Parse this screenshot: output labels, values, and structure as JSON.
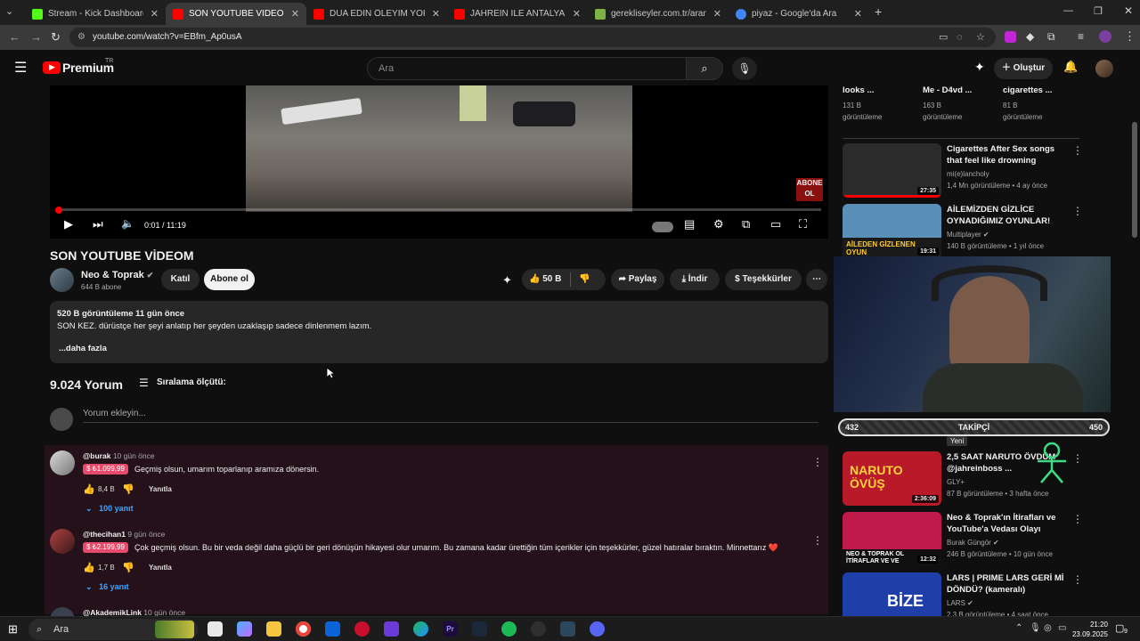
{
  "browser": {
    "tabs": [
      {
        "title": "Stream - Kick Dashboard",
        "color": "#53fc18"
      },
      {
        "title": "SON YOUTUBE VİDEOM - YouTube",
        "color": "#ff0000"
      },
      {
        "title": "DUA EDİN ÖLEYİM YOKSA ÇOK",
        "color": "#ff0000"
      },
      {
        "title": "JAHREIN İLE ANTALYA YEMEK T",
        "color": "#ff0000"
      },
      {
        "title": "gerekliseyler.com.tr/arama/İblek",
        "color": "#7cb342"
      },
      {
        "title": "piyaz - Google'da Ara",
        "color": "#4285f4"
      }
    ],
    "url": "youtube.com/watch?v=EBfm_Ap0usA",
    "new_tab_label": "+"
  },
  "youtube": {
    "logo_text": "Premium",
    "logo_region": "TR",
    "search_placeholder": "Ara",
    "create_label": "Oluştur"
  },
  "player": {
    "time": "0:01 / 11:19",
    "watermark": "ABONE OL",
    "progress_fraction": 0.0015
  },
  "video": {
    "title": "SON YOUTUBE VİDEOM",
    "channel": "Neo & Toprak",
    "subscribers": "644 B abone",
    "join_label": "Katıl",
    "subscribe_label": "Abone ol",
    "likes": "50 B",
    "share_label": "Paylaş",
    "download_label": "İndir",
    "thanks_label": "Teşekkürler",
    "description_meta": "520 B görüntüleme  11 gün önce",
    "description_text": "SON KEZ. dürüstçe her şeyi anlatıp her şeyden uzaklaşıp sadece dinlenmem lazım.",
    "more_label": "...daha fazla"
  },
  "comments": {
    "count_label": "9.024 Yorum",
    "sort_label": "Sıralama ölçütü:",
    "add_placeholder": "Yorum ekleyin...",
    "reply_label": "Yanıtla",
    "items": [
      {
        "user": "@burak",
        "time": "10 gün önce",
        "badge": "₺1.099,99",
        "text": "Geçmiş olsun, umarım toparlanıp aramıza dönersin.",
        "likes": "8,4 B",
        "replies": "100 yanıt"
      },
      {
        "user": "@thecihan1",
        "time": "9 gün önce",
        "badge": "₺2.199,99",
        "text": "Çok geçmiş olsun. Bu bir veda değil daha güçlü bir geri dönüşün hikayesi olur umarım. Bu zamana kadar ürettiğin tüm içerikler için teşekkürler, güzel hatıralar bıraktın. Minnettarız ❤️",
        "likes": "1,7 B",
        "replies": "16 yanıt"
      },
      {
        "user": "@AkademikLink",
        "time": "10 gün önce"
      }
    ]
  },
  "sidebar": {
    "top_row": [
      {
        "title": "looks ...",
        "views": "131 B",
        "unit": "görüntüleme"
      },
      {
        "title": "Me - D4vd ...",
        "views": "163 B",
        "unit": "görüntüleme"
      },
      {
        "title": "cigarettes ...",
        "views": "81 B",
        "unit": "görüntüleme"
      }
    ],
    "videos": [
      {
        "title": "Cigarettes After Sex songs that feel like drowning",
        "channel": "mi(e)lancholy",
        "meta": "1,4 Mn görüntüleme • 4 ay önce",
        "duration": "27:35",
        "thumb": "#2b2b2b"
      },
      {
        "title": "AİLEMİZDEN GİZLİCE OYNADIĞIMIZ OYUNLAR!",
        "channel": "Multiplayer",
        "meta": "140 B görüntüleme • 1 yıl önce",
        "duration": "19:31",
        "thumb": "#5a8fb8",
        "caption": "AİLEDEN GİZLENEN OYUN"
      },
      {
        "title": "2,5 SAAT NARUTO ÖVDÜM @jahreinboss ...",
        "channel": "GLY+",
        "meta": "87 B görüntüleme • 3 hafta önce",
        "duration": "2:36:09",
        "thumb": "#b81a2a",
        "caption": "NARUTO ÖVÜŞ",
        "new_badge": "Yeni"
      },
      {
        "title": "Neo & Toprak'ın İtirafları ve YouTube'a Vedası Olayı",
        "channel": "Burak Güngör",
        "meta": "246 B görüntüleme • 10 gün önce",
        "duration": "12:32",
        "thumb": "#c01a4a",
        "caption": "NEO & TOPRAK OL İTİRAFLAR VE VE"
      },
      {
        "title": "LARS | PRIME LARS GERİ Mİ DÖNDÜ? (kameralı)",
        "channel": "LARS",
        "meta": "2,3 B görüntüleme • 4 saat önce",
        "thumb": "#1e3fa8",
        "caption": "BİZE"
      }
    ]
  },
  "overlay": {
    "follower_left": "432",
    "follower_label": "TAKİPÇİ",
    "follower_right": "450"
  },
  "taskbar": {
    "search_label": "Ara",
    "time": "21:20",
    "date": "23.09.2025",
    "notif_count": "9"
  }
}
